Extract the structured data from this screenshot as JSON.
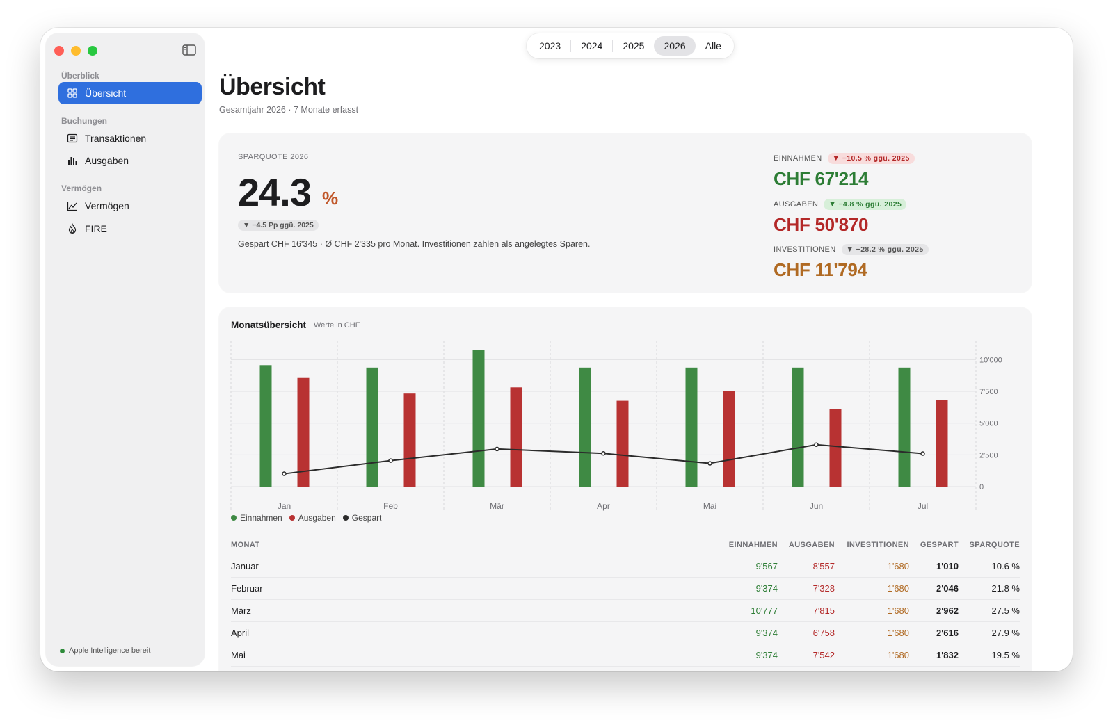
{
  "sidebar": {
    "sections": [
      {
        "label": "Überblick"
      },
      {
        "label": "Buchungen"
      },
      {
        "label": "Vermögen"
      }
    ],
    "items": [
      {
        "label": "Übersicht",
        "icon": "grid-icon"
      },
      {
        "label": "Transaktionen",
        "icon": "list-icon"
      },
      {
        "label": "Ausgaben",
        "icon": "bar-chart-icon"
      },
      {
        "label": "Vermögen",
        "icon": "line-chart-icon"
      },
      {
        "label": "FIRE",
        "icon": "flame-icon"
      }
    ],
    "footer": "Apple Intelligence bereit"
  },
  "years": [
    "2023",
    "2024",
    "2025",
    "2026",
    "Alle"
  ],
  "selected_year": "2026",
  "header": {
    "title": "Übersicht",
    "subtitle": "Gesamtjahr 2026 · 7 Monate erfasst"
  },
  "savings_rate": {
    "label": "SPARQUOTE 2026",
    "value": "24.3",
    "unit": "%",
    "delta": "▼ −4.5 Pp ggü. 2025",
    "description": "Gespart CHF 16'345 · Ø CHF 2'335 pro Monat. Investitionen zählen als angelegtes Sparen."
  },
  "kpis": {
    "income": {
      "label": "EINNAHMEN",
      "delta": "▼ −10.5 % ggü. 2025",
      "value": "CHF 67'214",
      "color": "#2d7d35"
    },
    "expenses": {
      "label": "AUSGABEN",
      "delta": "▼ −4.8 % ggü. 2025",
      "value": "CHF 50'870",
      "color": "#b32828"
    },
    "investments": {
      "label": "INVESTITIONEN",
      "delta": "▼ −28.2 % ggü. 2025",
      "value": "CHF 11'794",
      "color": "#b06a23"
    }
  },
  "chart": {
    "title": "Monatsübersicht",
    "subtitle": "Werte in CHF"
  },
  "chart_data": {
    "type": "bar",
    "categories": [
      "Jan",
      "Feb",
      "Mär",
      "Apr",
      "Mai",
      "Jun",
      "Jul"
    ],
    "series": [
      {
        "name": "Einnahmen",
        "type": "bar",
        "color": "#3f8a44",
        "values": [
          9567,
          9374,
          10777,
          9374,
          9374,
          9374,
          9374
        ]
      },
      {
        "name": "Ausgaben",
        "type": "bar",
        "color": "#b83232",
        "values": [
          8557,
          7328,
          7815,
          6758,
          7542,
          6100,
          6800
        ]
      },
      {
        "name": "Gespart",
        "type": "line",
        "color": "#2b2b2b",
        "values": [
          1010,
          2046,
          2962,
          2616,
          1832,
          3300,
          2600
        ]
      }
    ],
    "yticks": [
      "10'000",
      "7'500",
      "5'000",
      "2'500",
      "0"
    ],
    "ylim": [
      0,
      11500
    ],
    "grid": true,
    "legend": "bottom-left"
  },
  "table": {
    "headers": [
      "MONAT",
      "EINNAHMEN",
      "AUSGABEN",
      "INVESTITIONEN",
      "GESPART",
      "SPARQUOTE"
    ],
    "rows": [
      [
        "Januar",
        "9'567",
        "8'557",
        "1'680",
        "1'010",
        "10.6 %"
      ],
      [
        "Februar",
        "9'374",
        "7'328",
        "1'680",
        "2'046",
        "21.8 %"
      ],
      [
        "März",
        "10'777",
        "7'815",
        "1'680",
        "2'962",
        "27.5 %"
      ],
      [
        "April",
        "9'374",
        "6'758",
        "1'680",
        "2'616",
        "27.9 %"
      ],
      [
        "Mai",
        "9'374",
        "7'542",
        "1'680",
        "1'832",
        "19.5 %"
      ]
    ]
  }
}
